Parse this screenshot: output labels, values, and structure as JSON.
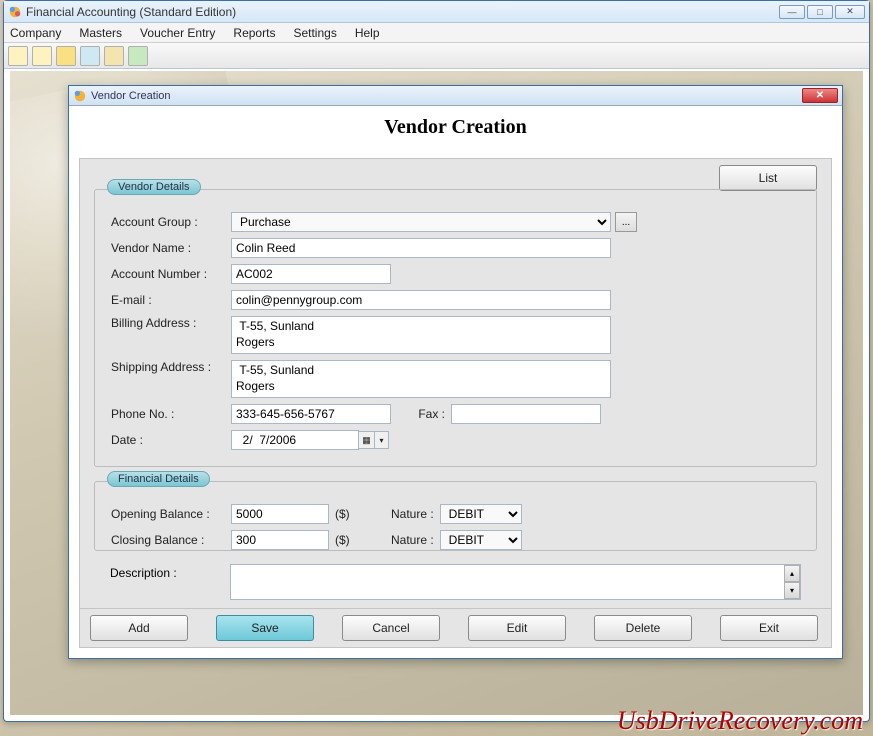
{
  "window": {
    "title": "Financial Accounting (Standard Edition)"
  },
  "menubar": [
    "Company",
    "Masters",
    "Voucher Entry",
    "Reports",
    "Settings",
    "Help"
  ],
  "dialog": {
    "titlebar": "Vendor Creation",
    "heading": "Vendor Creation",
    "list_button": "List",
    "vendor_details": {
      "legend": "Vendor Details",
      "labels": {
        "account_group": "Account Group :",
        "vendor_name": "Vendor Name :",
        "account_number": "Account Number :",
        "email": "E-mail :",
        "billing_address": "Billing Address :",
        "shipping_address": "Shipping Address :",
        "phone": "Phone No. :",
        "fax": "Fax :",
        "date": "Date :"
      },
      "values": {
        "account_group": "Purchase",
        "vendor_name": "Colin Reed",
        "account_number": "AC002",
        "email": "colin@pennygroup.com",
        "billing_address": " T-55, Sunland\nRogers",
        "shipping_address": " T-55, Sunland\nRogers",
        "phone": "333-645-656-5767",
        "fax": "",
        "date": "  2/  7/2006"
      }
    },
    "financial_details": {
      "legend": "Financial Details",
      "labels": {
        "opening": "Opening Balance :",
        "closing": "Closing Balance :",
        "nature": "Nature :",
        "currency": "($)"
      },
      "values": {
        "opening": "5000",
        "closing": "300",
        "nature_open": "DEBIT",
        "nature_close": "DEBIT"
      }
    },
    "description_label": "Description :",
    "description_value": ""
  },
  "buttons": {
    "add": "Add",
    "save": "Save",
    "cancel": "Cancel",
    "edit": "Edit",
    "delete": "Delete",
    "exit": "Exit"
  },
  "watermark": "UsbDriveRecovery.com"
}
